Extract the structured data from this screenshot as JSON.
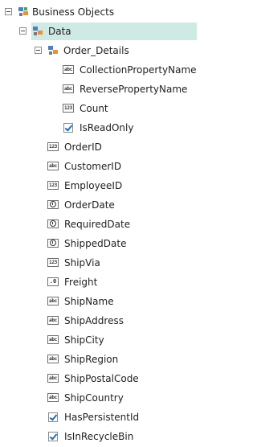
{
  "tree": {
    "root": {
      "label": "Business Objects",
      "toggle": "minus",
      "icon": "business-objects-icon"
    },
    "data_node": {
      "label": "Data",
      "toggle": "minus",
      "icon": "entity-icon",
      "selected": true
    },
    "order_details": {
      "label": "Order_Details",
      "toggle": "minus",
      "icon": "entity-icon"
    },
    "order_details_children": [
      {
        "label": "CollectionPropertyName",
        "type": "abc"
      },
      {
        "label": "ReversePropertyName",
        "type": "abc"
      },
      {
        "label": "Count",
        "type": "123"
      },
      {
        "label": "IsReadOnly",
        "type": "check"
      }
    ],
    "data_children": [
      {
        "label": "OrderID",
        "type": "123"
      },
      {
        "label": "CustomerID",
        "type": "abc"
      },
      {
        "label": "EmployeeID",
        "type": "123"
      },
      {
        "label": "OrderDate",
        "type": "clock"
      },
      {
        "label": "RequiredDate",
        "type": "clock"
      },
      {
        "label": "ShippedDate",
        "type": "clock"
      },
      {
        "label": "ShipVia",
        "type": "123"
      },
      {
        "label": "Freight",
        "type": "decimal"
      },
      {
        "label": "ShipName",
        "type": "abc"
      },
      {
        "label": "ShipAddress",
        "type": "abc"
      },
      {
        "label": "ShipCity",
        "type": "abc"
      },
      {
        "label": "ShipRegion",
        "type": "abc"
      },
      {
        "label": "ShipPostalCode",
        "type": "abc"
      },
      {
        "label": "ShipCountry",
        "type": "abc"
      },
      {
        "label": "HasPersistentId",
        "type": "check"
      },
      {
        "label": "IsInRecycleBin",
        "type": "check"
      }
    ],
    "type_glyphs": {
      "abc": "abc",
      "123": "123",
      "decimal": ".0"
    },
    "colors": {
      "selection": "#cfe9e4",
      "checkmark": "#1f6fb2",
      "entity_orange": "#e8913a",
      "entity_blue": "#4a7fc1"
    }
  }
}
